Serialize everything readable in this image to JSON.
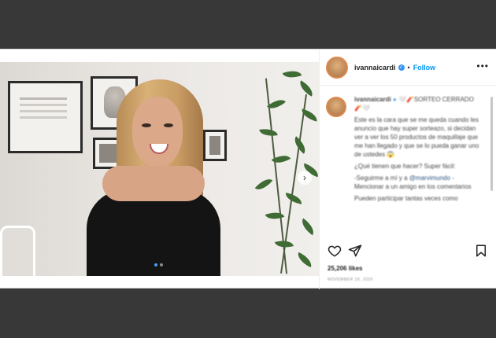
{
  "header": {
    "username": "ivannaicardi",
    "separator": "•",
    "follow_label": "Follow",
    "more_label": "•••"
  },
  "caption": {
    "username": "ivannaicardi",
    "title": "🤍🧨SORTEO CERRADO🧨🤍",
    "paragraph1": "Este es la cara que se me queda cuando les anuncio que hay super sorteazo, si decidan ver a ver los 50 productos de maquillaje que me han llegado y que se lo pueda ganar uno de ustedes 😱",
    "paragraph2": "¿Qué tienen que hacer? Super fácil:",
    "paragraph3_prefix": "-Seguirme a mí y a",
    "paragraph3_mention": "@marvimundo",
    "paragraph3_suffix": "-Mencionar a un amigo en los comentarios",
    "paragraph4": "Pueden participar tantas veces como"
  },
  "footer": {
    "likes": "25,206 likes",
    "date": "NOVEMBER 19, 2020"
  },
  "media": {
    "carousel_index": 1,
    "carousel_total": 2,
    "next_arrow": "›"
  },
  "icons": {
    "like": "heart-icon",
    "share": "send-icon",
    "save": "bookmark-icon",
    "verified": "verified-badge-icon"
  },
  "colors": {
    "link": "#0095f6",
    "verified": "#3897f0",
    "background": "#383838"
  }
}
